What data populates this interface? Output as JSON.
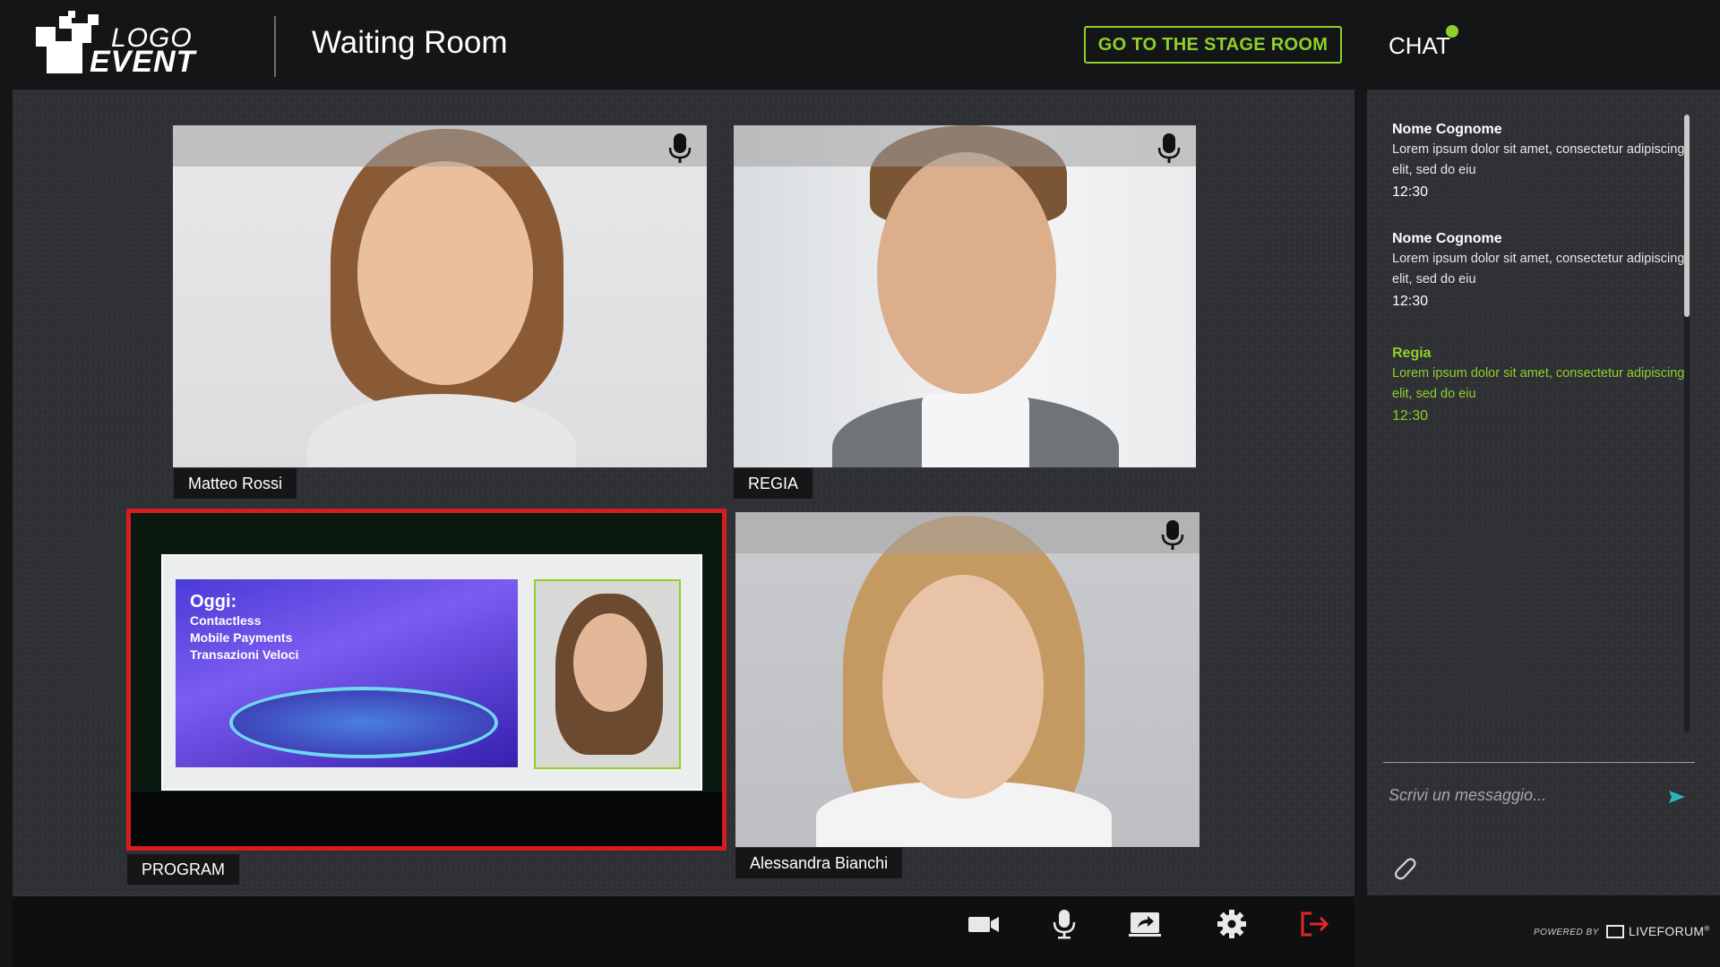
{
  "header": {
    "logo_line1": "LOGO",
    "logo_line2": "EVENT",
    "title": "Waiting Room",
    "stage_button": "GO TO THE STAGE ROOM",
    "chat_label": "CHAT"
  },
  "colors": {
    "accent": "#8fd02b",
    "program_border": "#d21e1e",
    "exit_icon": "#e0282a"
  },
  "participants": [
    {
      "name": "Matteo Rossi",
      "mic_icon": "microphone-icon"
    },
    {
      "name": "REGIA",
      "mic_icon": "microphone-icon"
    },
    {
      "name": "PROGRAM"
    },
    {
      "name": "Alessandra Bianchi",
      "mic_icon": "microphone-icon"
    }
  ],
  "program": {
    "heading": "Oggi:",
    "line1": "Contactless",
    "line2": "Mobile Payments",
    "line3": "Transazioni Veloci"
  },
  "chat": {
    "messages": [
      {
        "author": "Nome Cognome",
        "text": "Lorem ipsum dolor sit amet, consectetur adipiscing elit, sed do eiu",
        "time": "12:30"
      },
      {
        "author": "Nome Cognome",
        "text": "Lorem ipsum dolor sit amet, consectetur adipiscing elit, sed do eiu",
        "time": "12:30"
      },
      {
        "author": "Regia",
        "text": "Lorem ipsum dolor sit amet, consectetur adipiscing elit, sed do eiu",
        "time": "12:30"
      }
    ],
    "input_placeholder": "Scrivi un messaggio...",
    "send_icon": "send-icon",
    "attach_icon": "paperclip-icon"
  },
  "toolbar": {
    "icons": [
      "camera-icon",
      "microphone-icon",
      "share-screen-icon",
      "gear-icon",
      "exit-icon"
    ]
  },
  "footer": {
    "powered_by": "POWERED BY",
    "brand": "LIVEFORUM"
  }
}
